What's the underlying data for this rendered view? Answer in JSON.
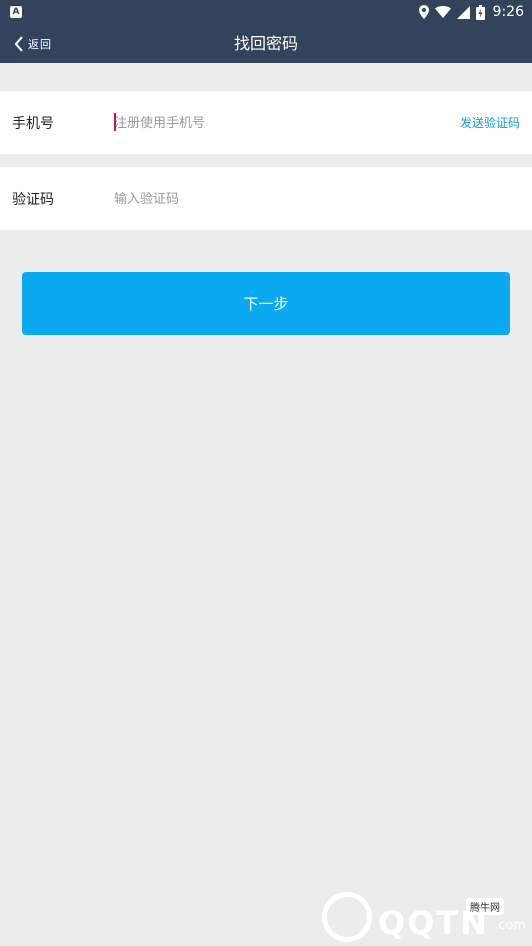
{
  "status_bar": {
    "notification_icon": "A",
    "time": "9:26"
  },
  "header": {
    "back_label": "返回",
    "title": "找回密码"
  },
  "form": {
    "phone": {
      "label": "手机号",
      "placeholder": "注册使用手机号",
      "value": "",
      "send_code_label": "发送验证码"
    },
    "code": {
      "label": "验证码",
      "placeholder": "输入验证码",
      "value": ""
    },
    "next_button_label": "下一步"
  },
  "watermark": {
    "brand": "QQTN",
    "suffix": ".com",
    "badge": "腾牛网"
  },
  "colors": {
    "header_bg": "#34435c",
    "page_bg": "#ececec",
    "accent": "#0aa9f0",
    "link": "#0a9fe0"
  }
}
